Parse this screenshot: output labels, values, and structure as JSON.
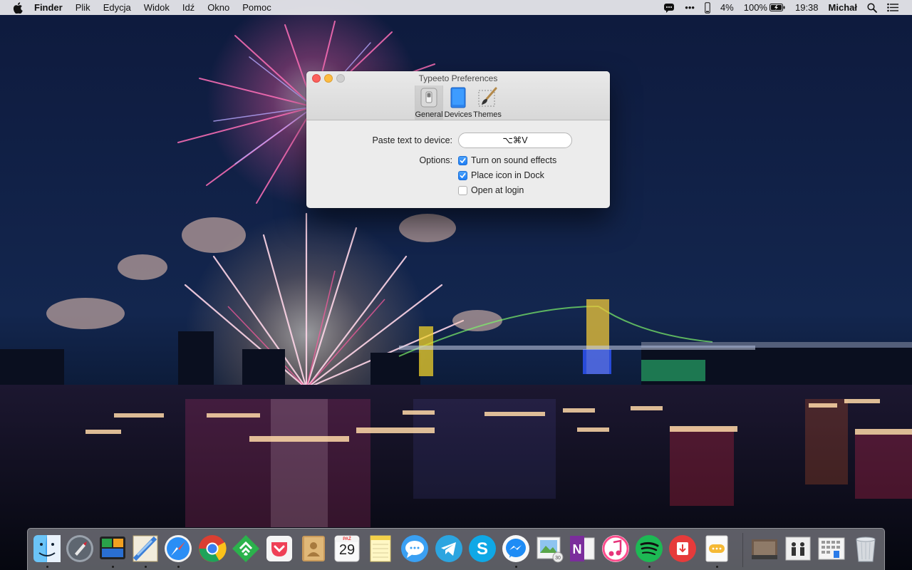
{
  "menubar": {
    "app_name": "Finder",
    "items": [
      "Plik",
      "Edycja",
      "Widok",
      "Idź",
      "Okno",
      "Pomoc"
    ],
    "status": {
      "overflow_glyph": "•••",
      "volume_percent": "4%",
      "battery": "100%",
      "time": "19:38",
      "user": "Michał"
    },
    "icons": [
      "apple-icon",
      "chat-bubble-icon",
      "ellipsis-icon",
      "phone-icon",
      "battery-icon",
      "spotlight-icon",
      "notification-center-icon"
    ]
  },
  "prefs_window": {
    "title": "Typeeto Preferences",
    "tabs": [
      {
        "label": "General",
        "icon": "switch-icon",
        "active": true
      },
      {
        "label": "Devices",
        "icon": "device-icon",
        "active": false
      },
      {
        "label": "Themes",
        "icon": "paintbrush-icon",
        "active": false
      }
    ],
    "paste_label": "Paste text to device:",
    "shortcut_value": "⌥⌘V",
    "options_label": "Options:",
    "options": [
      {
        "label": "Turn on sound effects",
        "checked": true
      },
      {
        "label": "Place icon in Dock",
        "checked": true
      },
      {
        "label": "Open at login",
        "checked": false
      }
    ]
  },
  "dock": {
    "apps": [
      {
        "name": "finder-icon",
        "running": true
      },
      {
        "name": "launchpad-icon",
        "running": false
      },
      {
        "name": "activity-monitor-icon",
        "running": true
      },
      {
        "name": "mail-icon",
        "running": true
      },
      {
        "name": "safari-icon",
        "running": true
      },
      {
        "name": "chrome-icon",
        "running": false
      },
      {
        "name": "feedly-icon",
        "running": false
      },
      {
        "name": "pocket-icon",
        "running": false
      },
      {
        "name": "contacts-icon",
        "running": false
      },
      {
        "name": "calendar-icon",
        "running": false
      },
      {
        "name": "notes-icon",
        "running": false
      },
      {
        "name": "messages-icon",
        "running": false
      },
      {
        "name": "telegram-icon",
        "running": false
      },
      {
        "name": "skype-icon",
        "running": false
      },
      {
        "name": "messenger-icon",
        "running": true
      },
      {
        "name": "preview-icon",
        "running": false
      },
      {
        "name": "onenote-icon",
        "running": false
      },
      {
        "name": "itunes-icon",
        "running": false
      },
      {
        "name": "spotify-icon",
        "running": true
      },
      {
        "name": "downloader-icon",
        "running": false
      },
      {
        "name": "typeeto-icon",
        "running": true
      }
    ],
    "calendar_month": "PAŹ",
    "calendar_day": "29",
    "stacks": [
      "downloads-stack-icon",
      "documents-stack-icon",
      "applications-stack-icon",
      "trash-icon"
    ]
  },
  "colors": {
    "accent": "#1f7ef5",
    "close": "#fc605c",
    "minimize": "#fdbc40"
  }
}
